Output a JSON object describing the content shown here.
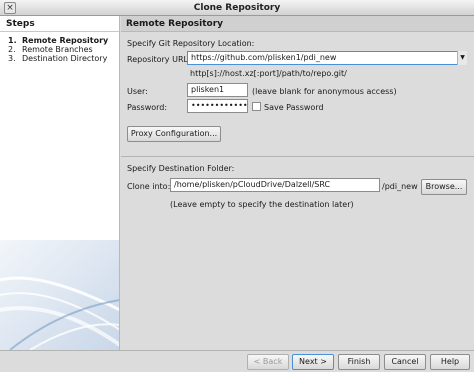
{
  "window": {
    "title": "Clone Repository",
    "close_glyph": "×"
  },
  "steps": {
    "header": "Steps",
    "items": [
      {
        "num": "1.",
        "label": "Remote Repository",
        "active": true
      },
      {
        "num": "2.",
        "label": "Remote Branches",
        "active": false
      },
      {
        "num": "3.",
        "label": "Destination Directory",
        "active": false
      }
    ]
  },
  "panel": {
    "header": "Remote Repository",
    "location_label": "Specify Git Repository Location:",
    "repo_url_label": "Repository URL:",
    "repo_url_value": "https://github.com/plisken1/pdi_new",
    "repo_url_hint": "http[s]://host.xz[:port]/path/to/repo.git/",
    "user_label": "User:",
    "user_value": "plisken1",
    "user_hint": "(leave blank for anonymous access)",
    "password_label": "Password:",
    "password_value": "••••••••••••••••",
    "save_password_label": "Save Password",
    "save_password_checked": false,
    "proxy_button": "Proxy Configuration...",
    "dest_label": "Specify Destination Folder:",
    "clone_into_label": "Clone into:",
    "clone_into_value": "/home/plisken/pCloudDrive/Dalzell/SRC",
    "clone_into_suffix": "/pdi_new",
    "browse_button": "Browse...",
    "dest_hint": "(Leave empty to specify the destination later)"
  },
  "footer": {
    "back": "< Back",
    "next": "Next >",
    "finish": "Finish",
    "cancel": "Cancel",
    "help": "Help"
  },
  "colors": {
    "accent": "#4a90d9",
    "panel_bg": "#dcdcdc",
    "steps_bg": "#ffffff"
  }
}
